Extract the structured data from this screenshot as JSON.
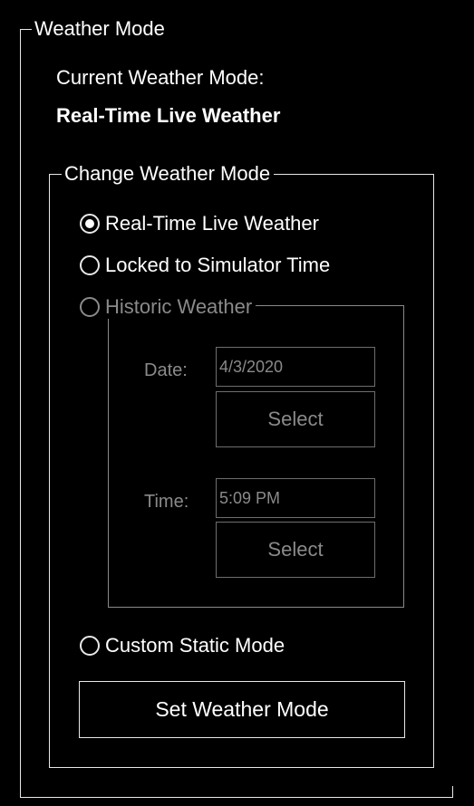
{
  "weather_mode": {
    "title": "Weather Mode",
    "current_label": "Current Weather Mode:",
    "current_value": "Real-Time Live Weather"
  },
  "change_mode": {
    "title": "Change Weather Mode",
    "options": [
      {
        "label": "Real-Time Live Weather",
        "checked": true,
        "enabled": true
      },
      {
        "label": "Locked to Simulator Time",
        "checked": false,
        "enabled": true
      },
      {
        "label": "Historic Weather",
        "checked": false,
        "enabled": false
      },
      {
        "label": "Custom Static Mode",
        "checked": false,
        "enabled": true
      }
    ],
    "set_button": "Set Weather Mode"
  },
  "historic": {
    "date_label": "Date:",
    "date_value": "4/3/2020",
    "date_select": "Select",
    "time_label": "Time:",
    "time_value": "5:09 PM",
    "time_select": "Select"
  },
  "colors": {
    "background": "#000000",
    "text": "#ffffff",
    "border": "#e8e8e8",
    "disabled": "#8a8a8a"
  }
}
